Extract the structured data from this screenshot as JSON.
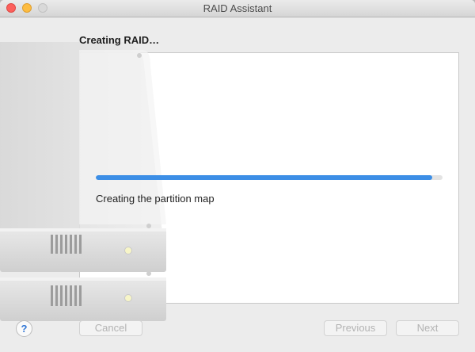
{
  "window": {
    "title": "RAID Assistant"
  },
  "page": {
    "heading": "Creating RAID…",
    "status_text": "Creating the partition map",
    "progress_fraction": 0.97
  },
  "buttons": {
    "help_label": "?",
    "cancel_label": "Cancel",
    "previous_label": "Previous",
    "next_label": "Next"
  },
  "icons": {
    "close": "traffic-close-icon",
    "minimize": "traffic-minimize-icon",
    "zoom": "traffic-zoom-icon",
    "drives": "raid-drives-illustration"
  },
  "colors": {
    "progress": "#3c8ee6",
    "window_bg": "#ececec"
  }
}
